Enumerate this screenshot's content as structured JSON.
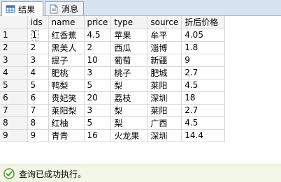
{
  "tabs": [
    {
      "label": "结果",
      "icon": "grid-results-icon",
      "active": true
    },
    {
      "label": "消息",
      "icon": "messages-icon",
      "active": false
    }
  ],
  "grid": {
    "columns": [
      "ids",
      "name",
      "price",
      "type",
      "source",
      "折后价格"
    ],
    "rows": [
      {
        "num": "1",
        "cells": [
          "1",
          "红香蕉",
          "4.5",
          "苹果",
          "牟平",
          "4.05"
        ]
      },
      {
        "num": "2",
        "cells": [
          "2",
          "黑美人",
          "2",
          "西瓜",
          "淄博",
          "1.8"
        ]
      },
      {
        "num": "3",
        "cells": [
          "3",
          "提子",
          "10",
          "葡萄",
          "新疆",
          "9"
        ]
      },
      {
        "num": "4",
        "cells": [
          "4",
          "肥桃",
          "3",
          "桃子",
          "肥城",
          "2.7"
        ]
      },
      {
        "num": "5",
        "cells": [
          "5",
          "鸭梨",
          "5",
          "梨",
          "莱阳",
          "4.5"
        ]
      },
      {
        "num": "6",
        "cells": [
          "6",
          "贵妃笑",
          "20",
          "荔枝",
          "深圳",
          "18"
        ]
      },
      {
        "num": "7",
        "cells": [
          "7",
          "莱阳梨",
          "3",
          "梨",
          "莱阳",
          "2.7"
        ]
      },
      {
        "num": "8",
        "cells": [
          "8",
          "红柚",
          "5",
          "梨",
          "广西",
          "4.5"
        ]
      },
      {
        "num": "9",
        "cells": [
          "9",
          "青青",
          "16",
          "火龙果",
          "深圳",
          "14.4"
        ]
      }
    ]
  },
  "status": {
    "text": "查询已成功执行。",
    "icon": "success-check-icon",
    "color": "#4a9a2a"
  }
}
